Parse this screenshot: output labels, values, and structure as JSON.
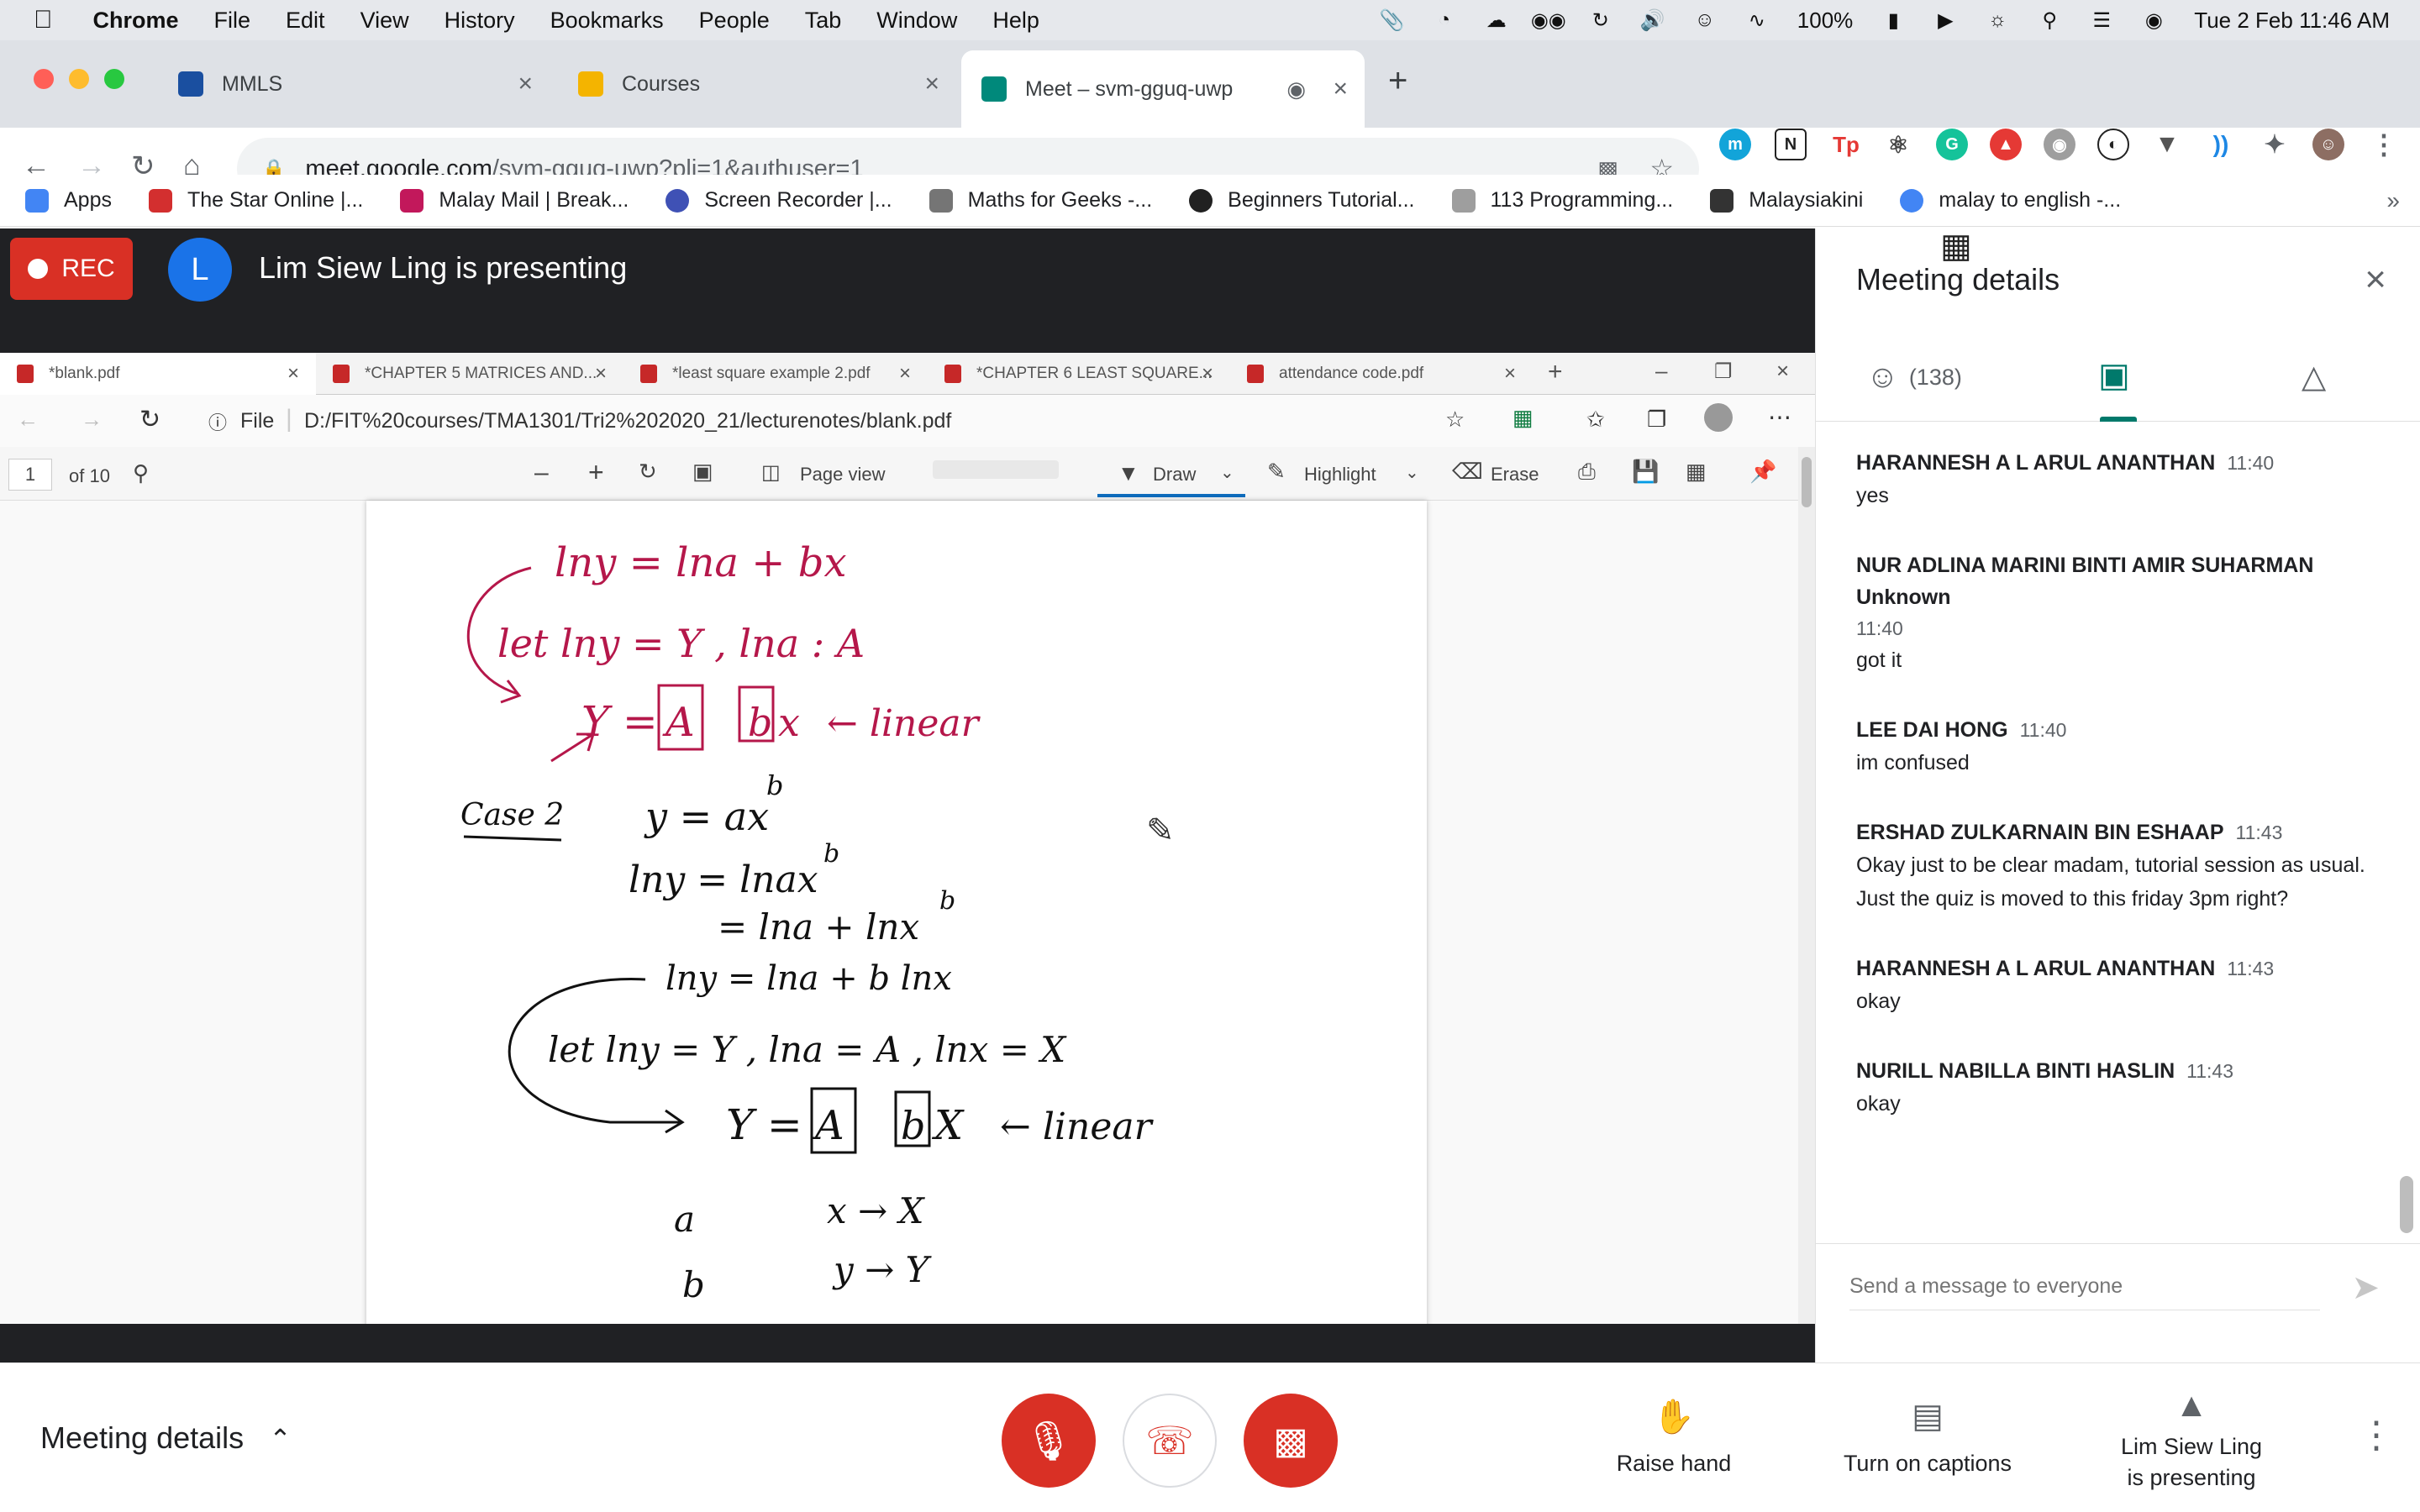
{
  "menubar": {
    "app_name": "Chrome",
    "menus": [
      "File",
      "Edit",
      "View",
      "History",
      "Bookmarks",
      "People",
      "Tab",
      "Window",
      "Help"
    ],
    "battery": "100%",
    "datetime": "Tue 2 Feb  11:46 AM"
  },
  "tabs": [
    {
      "title": "MMLS",
      "favicon_color": "#1a4fa0"
    },
    {
      "title": "Courses",
      "favicon_color": "#f4b400"
    },
    {
      "title": "Meet – svm-gguq-uwp",
      "favicon_color": "#00897b",
      "active": true
    }
  ],
  "address": {
    "host": "meet.google.com",
    "path": "/svm-gguq-uwp?pli=1&authuser=1"
  },
  "bookmarks": [
    {
      "label": "Apps",
      "color": "#4285f4"
    },
    {
      "label": "The Star Online |...",
      "color": "#d32f2f"
    },
    {
      "label": "Malay Mail | Break...",
      "color": "#c2185b"
    },
    {
      "label": "Screen Recorder |...",
      "color": "#3f51b5"
    },
    {
      "label": "Maths for Geeks -...",
      "color": "#757575"
    },
    {
      "label": "Beginners Tutorial...",
      "color": "#212121"
    },
    {
      "label": "113 Programming...",
      "color": "#9e9e9e"
    },
    {
      "label": "Malaysiakini",
      "color": "#333333"
    },
    {
      "label": "malay to english -...",
      "color": "#4285f4"
    }
  ],
  "meet": {
    "rec_label": "REC",
    "presenter_initial": "L",
    "presenting_text": "Lim Siew Ling is presenting"
  },
  "shared_screen": {
    "tabs": [
      "*blank.pdf",
      "*CHAPTER 5 MATRICES AND...",
      "*least square example 2.pdf",
      "*CHAPTER 6 LEAST SQUARE...",
      "attendance code.pdf"
    ],
    "file_label": "File",
    "file_path": "D:/FIT%20courses/TMA1301/Tri2%202020_21/lecturenotes/blank.pdf",
    "page_current": "1",
    "page_total": "of 10",
    "page_view": "Page view",
    "draw": "Draw",
    "highlight": "Highlight",
    "erase": "Erase",
    "handwriting": {
      "l1": "lny = lna + bx",
      "l2": "let lny = Y , lna : A",
      "l3a": "Y =",
      "l3A": "A",
      "l3b": "b",
      "l3x": "x",
      "l3lin": "← linear",
      "case": "Case 2",
      "c1": "y = ax",
      "c1sup": "b",
      "c2": "lny = lnax",
      "c2sup": "b",
      "c3": "= lna + lnx",
      "c3sup": "b",
      "c4": "lny = lna + b lnx",
      "c5": "let lny = Y ,   lna = A ,    lnx = X",
      "c6a": "Y =",
      "c6A": "A",
      "c6b": "b",
      "c6X": "X",
      "c6lin": "← linear",
      "r1a": "a",
      "r1b": "x → X",
      "r2a": "b",
      "r2b": "y → Y"
    }
  },
  "panel": {
    "title": "Meeting details",
    "people_count": "(138)",
    "messages": [
      {
        "sender": "HARANNESH A L ARUL ANANTHAN",
        "time": "11:40",
        "text": "yes"
      },
      {
        "sender": "NUR ADLINA MARINI BINTI AMIR SUHARMAN Unknown",
        "time": "11:40",
        "text": "got it"
      },
      {
        "sender": "LEE DAI HONG",
        "time": "11:40",
        "text": "im confused"
      },
      {
        "sender": "ERSHAD ZULKARNAIN BIN ESHAAP",
        "time": "11:43",
        "text": "Okay just to be clear madam, tutorial session as usual. Just the quiz is moved to this friday 3pm right?"
      },
      {
        "sender": "HARANNESH A L ARUL ANANTHAN",
        "time": "11:43",
        "text": "okay"
      },
      {
        "sender": "NURILL NABILLA BINTI HASLIN",
        "time": "11:43",
        "text": "okay"
      }
    ],
    "input_placeholder": "Send a message to everyone"
  },
  "bottombar": {
    "meeting_details": "Meeting details",
    "raise_hand": "Raise hand",
    "captions": "Turn on captions",
    "presenting_line1": "Lim Siew Ling",
    "presenting_line2": "is presenting"
  },
  "colors": {
    "danger": "#d93025",
    "accent": "#00796b",
    "ink": "#b5174a"
  }
}
